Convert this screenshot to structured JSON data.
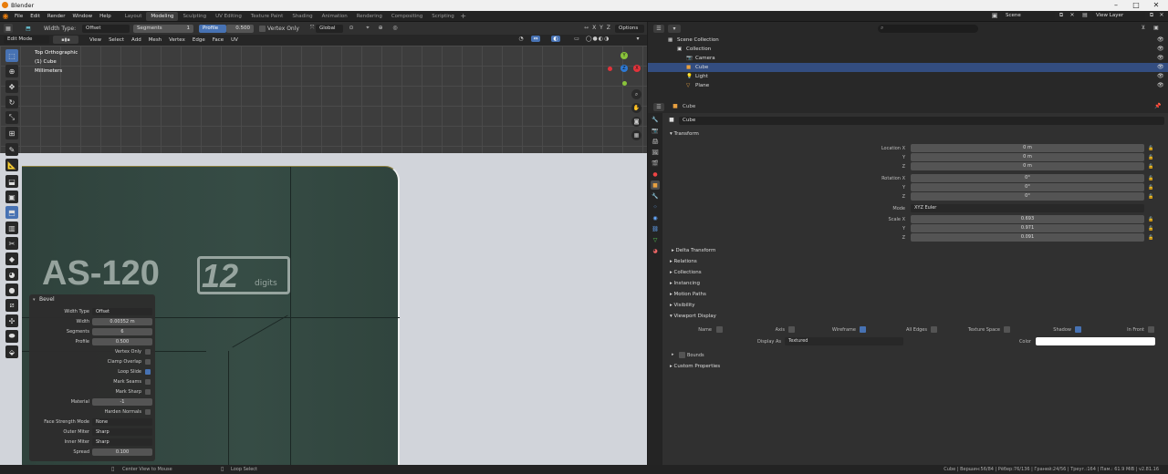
{
  "window": {
    "title": "Blender",
    "minimize": "–",
    "maximize": "□",
    "close": "✕"
  },
  "menu": [
    "File",
    "Edit",
    "Render",
    "Window",
    "Help"
  ],
  "workspaces": [
    {
      "label": "Layout",
      "active": false
    },
    {
      "label": "Modeling",
      "active": true
    },
    {
      "label": "Sculpting",
      "active": false
    },
    {
      "label": "UV Editing",
      "active": false
    },
    {
      "label": "Texture Paint",
      "active": false
    },
    {
      "label": "Shading",
      "active": false
    },
    {
      "label": "Animation",
      "active": false
    },
    {
      "label": "Rendering",
      "active": false
    },
    {
      "label": "Compositing",
      "active": false
    },
    {
      "label": "Scripting",
      "active": false
    }
  ],
  "scene": {
    "label": "Scene",
    "view_layer": "View Layer"
  },
  "toolheader": {
    "width_type_label": "Width Type:",
    "width_type_value": "Offset",
    "segments_label": "Segments",
    "segments_value": "1",
    "profile_label": "Profile",
    "profile_value": "0.500",
    "vertex_only": "Vertex Only",
    "orientation": "Global",
    "options": "Options"
  },
  "viewport_header": {
    "mode": "Edit Mode",
    "menus": [
      "View",
      "Select",
      "Add",
      "Mesh",
      "Vertex",
      "Edge",
      "Face",
      "UV"
    ]
  },
  "overlay_text": {
    "view": "Top Orthographic",
    "object": "(1) Cube",
    "units": "Millimeters"
  },
  "reference_image": {
    "model": "AS-120",
    "badge": "12",
    "badge_small": "digits"
  },
  "axis_gizmo": {
    "x": "X",
    "y": "Y",
    "z": "Z"
  },
  "bevel_panel": {
    "title": "Bevel",
    "rows": [
      {
        "label": "Width Type",
        "value": "Offset",
        "kind": "dropdown"
      },
      {
        "label": "Width",
        "value": "0.00352 m",
        "kind": "field"
      },
      {
        "label": "Segments",
        "value": "6",
        "kind": "field"
      },
      {
        "label": "Profile",
        "value": "0.500",
        "kind": "field"
      },
      {
        "label": "Vertex Only",
        "checked": false,
        "kind": "check"
      },
      {
        "label": "Clamp Overlap",
        "checked": false,
        "kind": "check"
      },
      {
        "label": "Loop Slide",
        "checked": true,
        "kind": "check"
      },
      {
        "label": "Mark Seams",
        "checked": false,
        "kind": "check"
      },
      {
        "label": "Mark Sharp",
        "checked": false,
        "kind": "check"
      },
      {
        "label": "Material",
        "value": "-1",
        "kind": "field"
      },
      {
        "label": "Harden Normals",
        "checked": false,
        "kind": "check"
      },
      {
        "label": "Face Strength Mode",
        "value": "None",
        "kind": "dropdown"
      },
      {
        "label": "Outer Miter",
        "value": "Sharp",
        "kind": "dropdown"
      },
      {
        "label": "Inner Miter",
        "value": "Sharp",
        "kind": "dropdown"
      },
      {
        "label": "Spread",
        "value": "0.100",
        "kind": "field"
      }
    ]
  },
  "statusbar": {
    "hint1": "Center View to Mouse",
    "hint2": "Loop Select",
    "stats": "Cube | Вершин:56/84 | Рёбер:76/136 | Граней:24/56 | Треуг.:164 | Пам.: 61.9 MiB | v2.81.16"
  },
  "outliner": {
    "search_placeholder": "",
    "items": [
      {
        "label": "Scene Collection",
        "indent": 0
      },
      {
        "label": "Collection",
        "indent": 1
      },
      {
        "label": "Camera",
        "indent": 2
      },
      {
        "label": "Cube",
        "indent": 2,
        "selected": true
      },
      {
        "label": "Light",
        "indent": 2
      },
      {
        "label": "Plane",
        "indent": 2
      }
    ]
  },
  "properties": {
    "object_name": "Cube",
    "datablock": "Cube",
    "transform": {
      "title": "Transform",
      "location": {
        "label": "Location X",
        "x": "0 m",
        "y": "0 m",
        "z": "0 m"
      },
      "rotation": {
        "label": "Rotation X",
        "x": "0°",
        "y": "0°",
        "z": "0°"
      },
      "mode": {
        "label": "Mode",
        "value": "XYZ Euler"
      },
      "scale": {
        "label": "Scale X",
        "x": "0.693",
        "y": "0.971",
        "z": "0.091"
      },
      "axis_y": "Y",
      "axis_z": "Z"
    },
    "delta": "Delta Transform",
    "sections": [
      "Relations",
      "Collections",
      "Instancing",
      "Motion Paths",
      "Visibility"
    ],
    "viewport_display": {
      "title": "Viewport Display",
      "name": "Name",
      "axis": "Axis",
      "wireframe": "Wireframe",
      "all_edges": "All Edges",
      "texture_space": "Texture Space",
      "shadow": "Shadow",
      "in_front": "In Front",
      "display_as_label": "Display As",
      "display_as": "Textured",
      "color": "Color",
      "bounds": "Bounds"
    },
    "custom": "Custom Properties"
  },
  "colors": {
    "accent": "#4772b3",
    "selection": "#334d80",
    "header": "#232323"
  }
}
